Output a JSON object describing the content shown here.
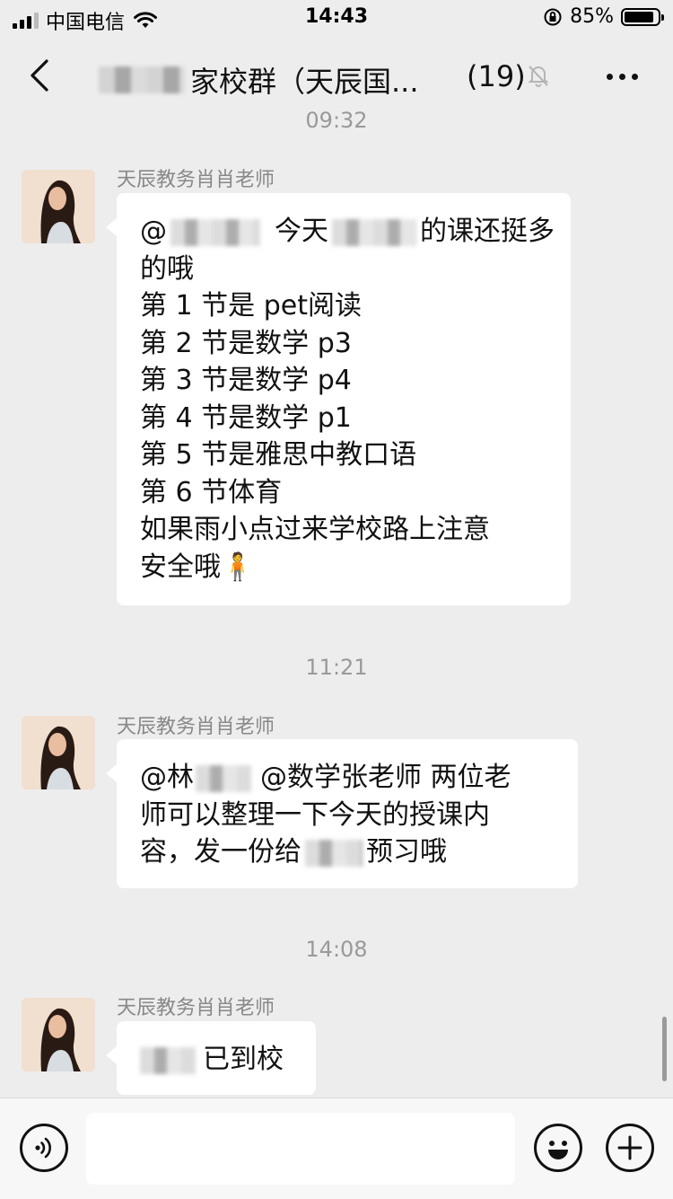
{
  "status_bar": {
    "carrier": "中国电信",
    "time": "14:43",
    "battery_percent": "85%"
  },
  "nav": {
    "title_suffix": "家校群（天辰国...",
    "member_count": "(19)"
  },
  "messages": [
    {
      "time": "09:32",
      "sender": "天辰教务肖肖老师",
      "lines": [
        {
          "pre": "@",
          "post": "今天",
          "post2": "的课还挺多"
        },
        {
          "text": "的哦"
        },
        {
          "text": "第 1 节是 pet阅读"
        },
        {
          "text": "第 2 节是数学 p3"
        },
        {
          "text": "第 3 节是数学 p4"
        },
        {
          "text": "第 4 节是数学 p1"
        },
        {
          "text": "第 5 节是雅思中教口语"
        },
        {
          "text": "第 6 节体育"
        },
        {
          "text": "如果雨小点过来学校路上注意"
        },
        {
          "text": "安全哦",
          "emoji": "🧍"
        }
      ]
    },
    {
      "time": "11:21",
      "sender": "天辰教务肖肖老师",
      "lines": [
        {
          "pre": "@林",
          "post": "@数学张老师 两位老"
        },
        {
          "text": "师可以整理一下今天的授课内"
        },
        {
          "pre": "容，发一份给",
          "post": "预习哦"
        }
      ]
    },
    {
      "time": "14:08",
      "sender": "天辰教务肖肖老师",
      "lines": [
        {
          "post": "已到校"
        }
      ]
    }
  ],
  "icons": {
    "back": "chevron-left-icon",
    "mute": "bell-slash-icon",
    "more": "more-dots-icon",
    "voice": "voice-icon",
    "emoji": "emoji-icon",
    "plus": "plus-icon"
  }
}
